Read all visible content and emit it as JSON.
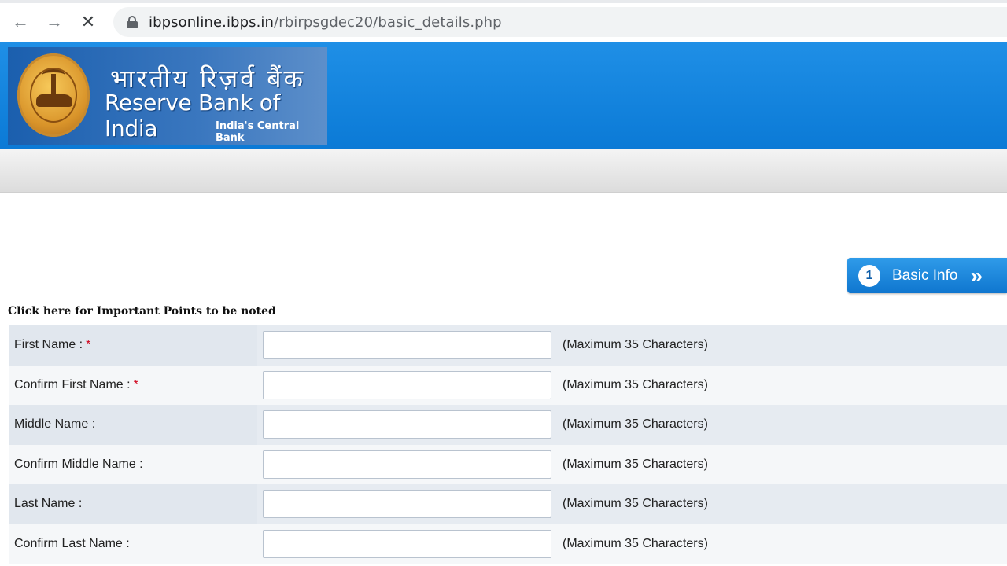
{
  "browser": {
    "url_host": "ibpsonline.ibps.in",
    "url_path": "/rbirpsgdec20/basic_details.php"
  },
  "header": {
    "hindi_name": "भारतीय रिज़र्व बैंक",
    "english_name": "Reserve Bank of India",
    "tagline": "India's Central Bank"
  },
  "step": {
    "number": "1",
    "label": "Basic Info",
    "arrows": "»"
  },
  "notice_link": "Click here for Important Points to be noted",
  "form": {
    "rows": [
      {
        "label": "First Name :",
        "required": "*",
        "value": "",
        "hint": "(Maximum 35 Characters)"
      },
      {
        "label": "Confirm First Name :",
        "required": "*",
        "value": "",
        "hint": "(Maximum 35 Characters)"
      },
      {
        "label": "Middle Name :",
        "required": "",
        "value": "",
        "hint": "(Maximum 35 Characters)"
      },
      {
        "label": "Confirm Middle Name :",
        "required": "",
        "value": "",
        "hint": "(Maximum 35 Characters)"
      },
      {
        "label": "Last Name :",
        "required": "",
        "value": "",
        "hint": "(Maximum 35 Characters)"
      },
      {
        "label": "Confirm Last Name :",
        "required": "",
        "value": "",
        "hint": "(Maximum 35 Characters)"
      }
    ]
  },
  "colors": {
    "banner_blue": "#0b7ad6",
    "step_blue": "#0f76cf",
    "required_red": "#d0021b",
    "row_shade": "#e6ebf1"
  },
  "icons": {
    "back": "arrow-left-icon",
    "forward": "arrow-right-icon",
    "stop": "close-icon",
    "lock": "lock-icon"
  }
}
